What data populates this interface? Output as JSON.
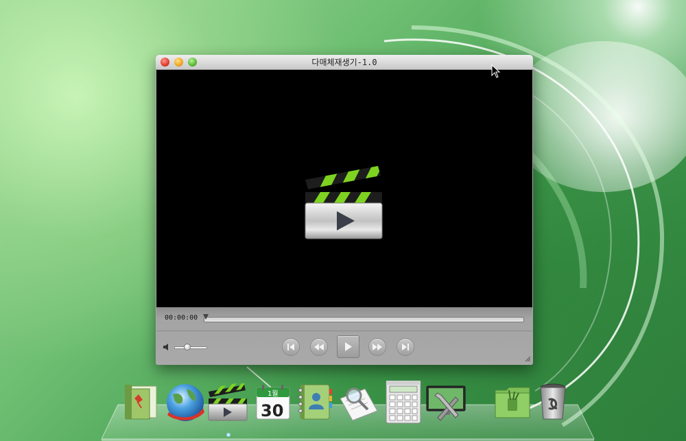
{
  "window": {
    "title": "다매체재생기-1.0",
    "time": "00:00:00",
    "playback_progress": 0,
    "volume_level": 0.4
  },
  "controls": {
    "buttons": [
      "skip-back",
      "rewind",
      "play",
      "fast-forward",
      "skip-forward"
    ]
  },
  "dock": {
    "items": [
      {
        "name": "document-folder-icon"
      },
      {
        "name": "globe-browser-icon"
      },
      {
        "name": "media-player-icon"
      },
      {
        "name": "calendar-icon",
        "month": "1월",
        "day": "30"
      },
      {
        "name": "address-book-icon"
      },
      {
        "name": "document-search-icon"
      },
      {
        "name": "calculator-icon"
      },
      {
        "name": "system-settings-icon"
      },
      {
        "name": "text-editor-folder-icon"
      },
      {
        "name": "trash-icon"
      }
    ]
  },
  "colors": {
    "clapper_green": "#7ed321",
    "window_frame": "#a9a9a9",
    "desktop_green": "#4fa95a"
  }
}
